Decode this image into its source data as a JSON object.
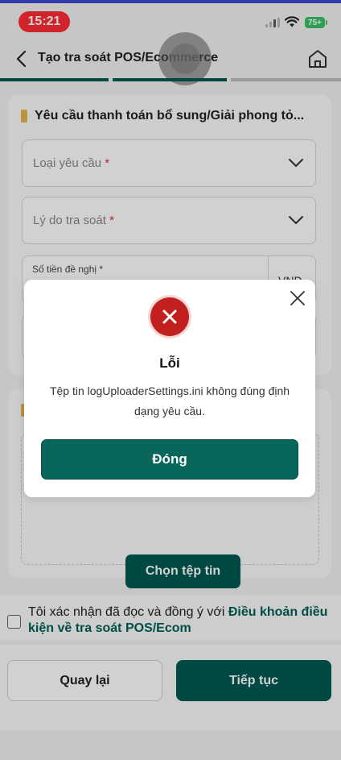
{
  "status_bar": {
    "time": "15:21",
    "battery": "75+"
  },
  "nav": {
    "title": "Tạo tra soát POS/Ecommerce"
  },
  "form": {
    "section_title": "Yêu cầu thanh toán bổ sung/Giải phong tỏ...",
    "request_type_label": "Loại yêu cầu",
    "reason_label": "Lý do tra soát",
    "required_mark": "*",
    "amount_label": "Số tiền đề nghị",
    "currency": "VND"
  },
  "upload": {
    "choose_file_label": "Chọn tệp tin"
  },
  "consent": {
    "text": "Tôi xác nhận đã đọc và đồng ý với ",
    "link": "Điều khoản điều kiện về tra soát POS/Ecom"
  },
  "footer": {
    "back_label": "Quay lại",
    "next_label": "Tiếp tục"
  },
  "dialog": {
    "title": "Lỗi",
    "message": "Tệp tin logUploaderSettings.ini không đúng định dạng yêu cầu.",
    "button_label": "Đóng"
  },
  "colors": {
    "primary": "#005a52",
    "error": "#c21f1f",
    "accent": "#e3b64a"
  }
}
